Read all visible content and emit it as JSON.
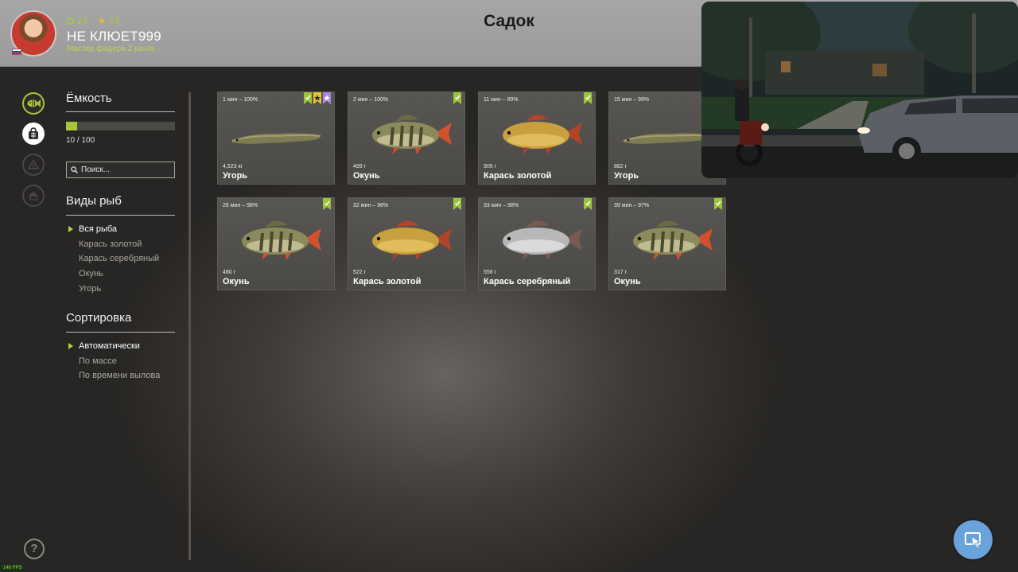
{
  "player": {
    "coins": "24",
    "stars": "14",
    "name": "НЕ КЛЮЕТ999",
    "rank": "Мастер фидера 2 ранга"
  },
  "page": {
    "title": "Садок"
  },
  "capacity": {
    "title": "Ёмкость",
    "current": 10,
    "max": 100,
    "text": "10 / 100",
    "fill_fraction": 0.1
  },
  "search": {
    "placeholder": "Поиск..."
  },
  "species": {
    "title": "Виды рыб",
    "items": [
      "Вся рыба",
      "Карась золотой",
      "Карась серебряный",
      "Окунь",
      "Угорь"
    ],
    "active_index": 0
  },
  "sort": {
    "title": "Сортировка",
    "items": [
      "Автоматически",
      "По массе",
      "По времени вылова"
    ],
    "active_index": 0
  },
  "fish": [
    {
      "time": "1 мин – 100%",
      "weight": "4,523 кг",
      "name": "Угорь",
      "kind": "eel",
      "badges": [
        "green",
        "yellow",
        "purple"
      ]
    },
    {
      "time": "2 мин – 100%",
      "weight": "499 г",
      "name": "Окунь",
      "kind": "perch",
      "badges": [
        "green"
      ]
    },
    {
      "time": "11 мин – 99%",
      "weight": "905 г",
      "name": "Карась золотой",
      "kind": "gold",
      "badges": [
        "green"
      ]
    },
    {
      "time": "15 мин – 99%",
      "weight": "882 г",
      "name": "Угорь",
      "kind": "eel",
      "badges": [
        "green"
      ]
    },
    {
      "time": "26 мин – 98%",
      "weight": "480 г",
      "name": "Окунь",
      "kind": "perch",
      "badges": [
        "green"
      ]
    },
    {
      "time": "32 мин – 98%",
      "weight": "522 г",
      "name": "Карась золотой",
      "kind": "gold",
      "badges": [
        "green"
      ]
    },
    {
      "time": "33 мин – 98%",
      "weight": "556 г",
      "name": "Карась серебряный",
      "kind": "silver",
      "badges": [
        "green"
      ]
    },
    {
      "time": "39 мин – 97%",
      "weight": "317 г",
      "name": "Окунь",
      "kind": "perch",
      "badges": [
        "green"
      ]
    }
  ],
  "colors": {
    "accent": "#a9c63a",
    "badge_green": "#9cc43a",
    "badge_yellow": "#e8c531",
    "badge_purple": "#a983e0",
    "header_bg": "#a2a2a2"
  },
  "icons": {
    "nav": [
      "fish-icon",
      "keepnet-bag-icon",
      "tent-icon",
      "house-icon"
    ],
    "help": "?",
    "fps": "146 FPS"
  }
}
